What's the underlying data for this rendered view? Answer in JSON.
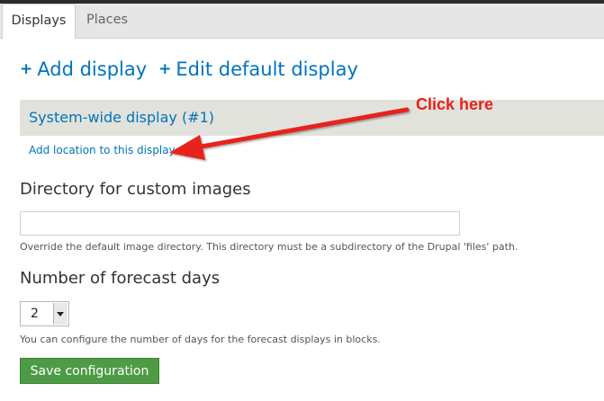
{
  "tabs": [
    {
      "label": "Displays",
      "active": true
    },
    {
      "label": "Places",
      "active": false
    }
  ],
  "actions": {
    "add_display": "Add display",
    "edit_default_display": "Edit default display"
  },
  "section": {
    "title": "System-wide display (#1)",
    "add_location_link": "Add location to this display"
  },
  "form": {
    "directory": {
      "label": "Directory for custom images",
      "value": "",
      "description": "Override the default image directory. This directory must be a subdirectory of the Drupal 'files' path."
    },
    "forecast_days": {
      "label": "Number of forecast days",
      "selected": "2",
      "description": "You can configure the number of days for the forecast displays in blocks."
    },
    "save_label": "Save configuration"
  },
  "annotation": {
    "text": "Click here",
    "color": "#e8211a"
  },
  "colors": {
    "link": "#0074bd",
    "section_bg": "#e2e2dc",
    "button_bg": "#4e9b45"
  }
}
